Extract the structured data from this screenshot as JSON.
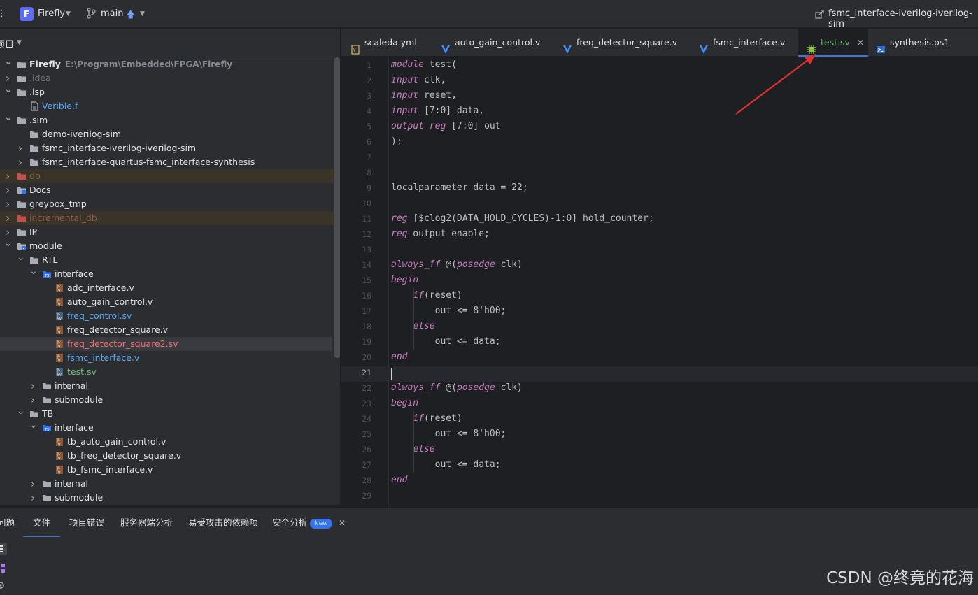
{
  "titlebar": {
    "project_initial": "F",
    "project_name": "Firefly",
    "branch": "main",
    "run_config": "fsmc_interface-iverilog-iverilog-sim"
  },
  "project_panel": {
    "header": "项目"
  },
  "tree": [
    {
      "label": "Firefly",
      "path": "E:\\Program\\Embedded\\FPGA\\Firefly",
      "icon": "folder-icon"
    },
    {
      "label": ".idea",
      "icon": "folder-icon"
    },
    {
      "label": ".lsp",
      "icon": "folder-icon"
    },
    {
      "label": "Verible.f",
      "icon": "file-icon"
    },
    {
      "label": ".sim",
      "icon": "folder-icon"
    },
    {
      "label": "demo-iverilog-sim",
      "icon": "folder-icon"
    },
    {
      "label": "fsmc_interface-iverilog-iverilog-sim",
      "icon": "folder-icon"
    },
    {
      "label": "fsmc_interface-quartus-fsmc_interface-synthesis",
      "icon": "folder-icon"
    },
    {
      "label": "db",
      "icon": "database-folder-icon"
    },
    {
      "label": "Docs",
      "icon": "docs-folder-icon"
    },
    {
      "label": "greybox_tmp",
      "icon": "folder-icon"
    },
    {
      "label": "incremental_db",
      "icon": "database-folder-icon"
    },
    {
      "label": "IP",
      "icon": "folder-icon"
    },
    {
      "label": "module",
      "icon": "module-folder-icon"
    },
    {
      "label": "RTL",
      "icon": "folder-icon"
    },
    {
      "label": "interface",
      "icon": "ts-folder-icon"
    },
    {
      "label": "adc_interface.v",
      "icon": "verilog-file-icon"
    },
    {
      "label": "auto_gain_control.v",
      "icon": "verilog-file-icon"
    },
    {
      "label": "freq_control.sv",
      "icon": "systemverilog-file-icon"
    },
    {
      "label": "freq_detector_square.v",
      "icon": "verilog-file-icon"
    },
    {
      "label": "freq_detector_square2.sv",
      "icon": "verilog-file-icon"
    },
    {
      "label": "fsmc_interface.v",
      "icon": "verilog-file-icon"
    },
    {
      "label": "test.sv",
      "icon": "systemverilog-file-icon"
    },
    {
      "label": "internal",
      "icon": "folder-icon"
    },
    {
      "label": "submodule",
      "icon": "folder-icon"
    },
    {
      "label": "TB",
      "icon": "folder-icon"
    },
    {
      "label": "interface",
      "icon": "ts-folder-icon"
    },
    {
      "label": "tb_auto_gain_control.v",
      "icon": "verilog-file-icon"
    },
    {
      "label": "tb_freq_detector_square.v",
      "icon": "verilog-file-icon"
    },
    {
      "label": "tb_fsmc_interface.v",
      "icon": "verilog-file-icon"
    },
    {
      "label": "internal",
      "icon": "folder-icon"
    },
    {
      "label": "submodule",
      "icon": "folder-icon"
    }
  ],
  "tabs": [
    {
      "label": "scaleda.yml",
      "icon": "yaml-icon"
    },
    {
      "label": "auto_gain_control.v",
      "icon": "verilog-v-icon"
    },
    {
      "label": "freq_detector_square.v",
      "icon": "verilog-v-icon"
    },
    {
      "label": "fsmc_interface.v",
      "icon": "verilog-v-icon"
    },
    {
      "label": "test.sv",
      "icon": "chip-icon",
      "active": true
    },
    {
      "label": "synthesis.ps1",
      "icon": "powershell-icon"
    }
  ],
  "editor": {
    "line_numbers": [
      "1",
      "2",
      "3",
      "4",
      "5",
      "6",
      "7",
      "8",
      "9",
      "10",
      "11",
      "12",
      "13",
      "14",
      "15",
      "16",
      "17",
      "18",
      "19",
      "20",
      "21",
      "22",
      "23",
      "24",
      "25",
      "26",
      "27",
      "28",
      "29"
    ],
    "current_line": 21,
    "lines": [
      "module test(",
      "input clk,",
      "input reset,",
      "input [7:0] data,",
      "output reg [7:0] out",
      ");",
      "",
      "",
      "localparameter data = 22;",
      "",
      "reg [$clog2(DATA_HOLD_CYCLES)-1:0] hold_counter;",
      "reg output_enable;",
      "",
      "always_ff @(posedge clk)",
      "begin",
      "    if(reset)",
      "        out <= 8'h00;",
      "    else",
      "        out <= data;",
      "end",
      "",
      "always_ff @(posedge clk)",
      "begin",
      "    if(reset)",
      "        out <= 8'h00;",
      "    else",
      "        out <= data;",
      "end",
      ""
    ]
  },
  "bottom_panel": {
    "tabs": [
      "问题",
      "文件",
      "项目错误",
      "服务器端分析",
      "易受攻击的依赖项",
      "安全分析"
    ],
    "new_badge": "New"
  },
  "watermark": "CSDN @终竟的花海"
}
